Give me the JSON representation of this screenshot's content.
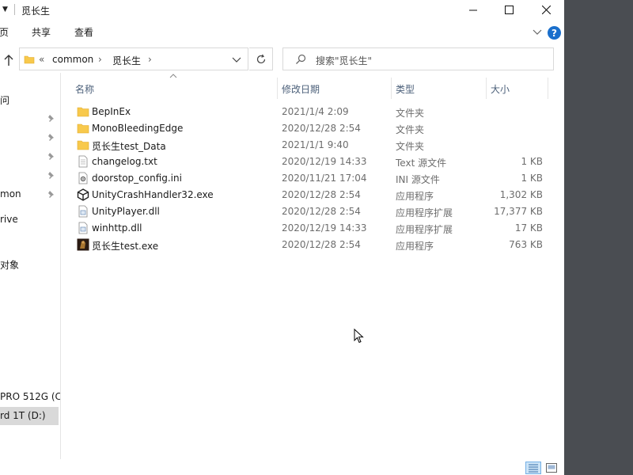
{
  "titlebar": {
    "title": "觅长生"
  },
  "ribbon": {
    "tabs": [
      "页",
      "共享",
      "查看"
    ]
  },
  "address": {
    "overflow": "«",
    "crumbs": [
      "common",
      "觅长生"
    ]
  },
  "search": {
    "placeholder": "搜索\"觅长生\""
  },
  "navpane": {
    "items": [
      "问",
      "",
      "",
      "",
      "mon",
      "rive",
      "对象",
      "PRO 512G (C:",
      "rd 1T (D:)"
    ],
    "selected_index": 8
  },
  "columns": {
    "name": "名称",
    "date": "修改日期",
    "type": "类型",
    "size": "大小"
  },
  "files": [
    {
      "name": "BepInEx",
      "date": "2021/1/4 2:09",
      "type": "文件夹",
      "size": "",
      "icon": "folder-icon"
    },
    {
      "name": "MonoBleedingEdge",
      "date": "2020/12/28 2:54",
      "type": "文件夹",
      "size": "",
      "icon": "folder-icon"
    },
    {
      "name": "觅长生test_Data",
      "date": "2021/1/1 9:40",
      "type": "文件夹",
      "size": "",
      "icon": "folder-icon"
    },
    {
      "name": "changelog.txt",
      "date": "2020/12/19 14:33",
      "type": "Text 源文件",
      "size": "1 KB",
      "icon": "text-file-icon"
    },
    {
      "name": "doorstop_config.ini",
      "date": "2020/11/21 17:04",
      "type": "INI 源文件",
      "size": "1 KB",
      "icon": "config-file-icon"
    },
    {
      "name": "UnityCrashHandler32.exe",
      "date": "2020/12/28 2:54",
      "type": "应用程序",
      "size": "1,302 KB",
      "icon": "unity-icon"
    },
    {
      "name": "UnityPlayer.dll",
      "date": "2020/12/28 2:54",
      "type": "应用程序扩展",
      "size": "17,377 KB",
      "icon": "dll-file-icon"
    },
    {
      "name": "winhttp.dll",
      "date": "2020/12/19 14:33",
      "type": "应用程序扩展",
      "size": "17 KB",
      "icon": "dll-file-icon"
    },
    {
      "name": "觅长生test.exe",
      "date": "2020/12/28 2:54",
      "type": "应用程序",
      "size": "763 KB",
      "icon": "game-exe-icon"
    }
  ],
  "colors": {
    "folder": "#f8c94c",
    "header_text": "#4c607a",
    "selection": "#d9d9d9",
    "accent": "#1a6fcc"
  }
}
